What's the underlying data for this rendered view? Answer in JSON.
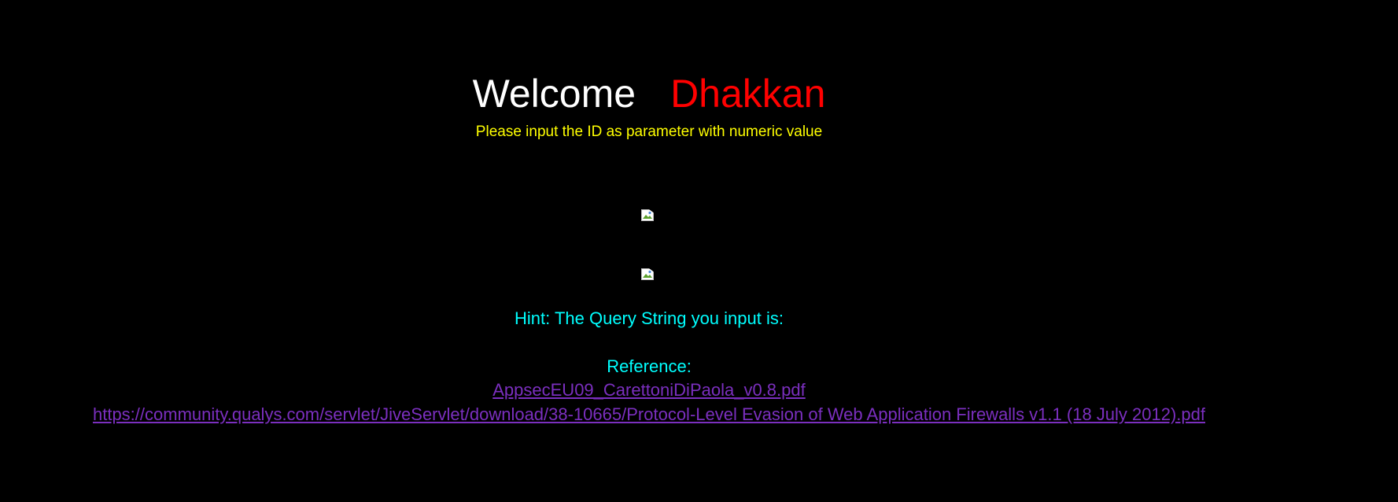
{
  "header": {
    "welcome_word": "Welcome",
    "welcome_name": "Dhakkan",
    "subtitle": "Please input the ID as parameter with numeric value"
  },
  "images": [
    {
      "icon": "broken-image-icon"
    },
    {
      "icon": "broken-image-icon"
    }
  ],
  "hint": {
    "text": "Hint: The Query String you input is:"
  },
  "reference": {
    "label": "Reference:",
    "links": [
      {
        "text": "AppsecEU09_CarettoniDiPaola_v0.8.pdf"
      },
      {
        "text": "https://community.qualys.com/servlet/JiveServlet/download/38-10665/Protocol-Level Evasion of Web Application Firewalls v1.1 (18 July 2012).pdf"
      }
    ]
  },
  "colors": {
    "background": "#000000",
    "welcome": "#ffffff",
    "name": "#ff0000",
    "subtitle": "#ffff00",
    "hint": "#00ffff",
    "link": "#7b2fbf"
  }
}
